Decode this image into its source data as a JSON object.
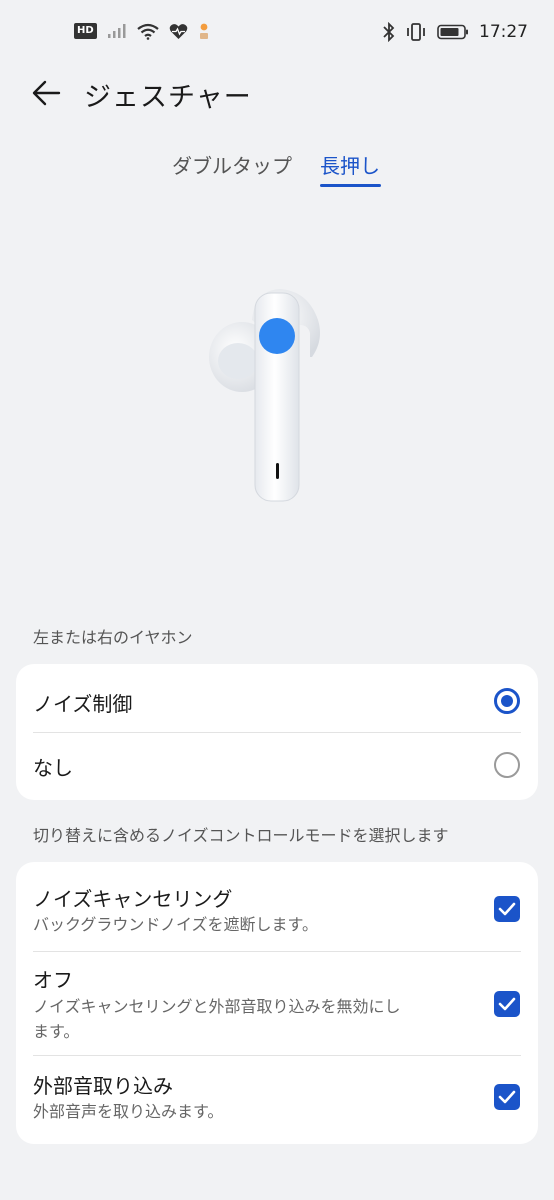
{
  "statusbar": {
    "hd": "HD",
    "time": "17:27",
    "icons_left": [
      "hd-icon",
      "signal-icon",
      "wifi-icon",
      "health-icon",
      "notification-icon"
    ],
    "icons_right": [
      "bluetooth-icon",
      "vibrate-icon",
      "battery-icon"
    ]
  },
  "header": {
    "title": "ジェスチャー"
  },
  "tabs": [
    {
      "label": "ダブルタップ",
      "active": false
    },
    {
      "label": "長押し",
      "active": true
    }
  ],
  "section1": {
    "label": "左または右のイヤホン",
    "options": [
      {
        "label": "ノイズ制御",
        "selected": true
      },
      {
        "label": "なし",
        "selected": false
      }
    ]
  },
  "section2": {
    "label": "切り替えに含めるノイズコントロールモードを選択します",
    "items": [
      {
        "title": "ノイズキャンセリング",
        "subtitle": "バックグラウンドノイズを遮断します。",
        "checked": true
      },
      {
        "title": "オフ",
        "subtitle_line1": "ノイズキャンセリングと外部音取り込みを無効にし",
        "subtitle_line2": "ます。",
        "checked": true
      },
      {
        "title": "外部音取り込み",
        "subtitle": "外部音声を取り込みます。",
        "checked": true
      }
    ]
  },
  "colors": {
    "accent": "#1b54c9",
    "background": "#f1f2f4",
    "earbud_touch": "#2f86f0"
  }
}
